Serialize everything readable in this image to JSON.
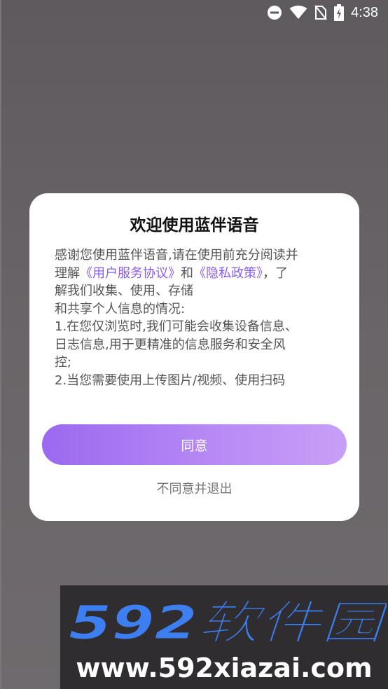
{
  "status_bar": {
    "time": "4:38",
    "icons": [
      "do-not-disturb-icon",
      "wifi-icon",
      "no-sim-icon",
      "battery-charging-icon"
    ]
  },
  "dialog": {
    "title": "欢迎使用蓝伴语音",
    "body": {
      "line1": "感谢您使用蓝伴语音,请在使用前充分阅读并",
      "line2_prefix": "理解",
      "user_agreement_link": "《用户服务协议》",
      "line2_and": "和",
      "privacy_policy_link": "《隐私政策》",
      "line2_suffix": "，了",
      "line3": "解我们收集、使用、存储",
      "line4": "和共享个人信息的情况:",
      "line5": "1.在您仅浏览时,我们可能会收集设备信息、",
      "line6": "日志信息,用于更精准的信息服务和安全风",
      "line7": "控;",
      "line8": "2.当您需要使用上传图片/视频、使用扫码"
    },
    "agree_label": "同意",
    "disagree_label": "不同意并退出"
  },
  "watermark": {
    "logo_text": "592软件园",
    "url": "www.592xiazai.com"
  },
  "colors": {
    "link": "#8a5cf0",
    "button_gradient_start": "#9a69f0",
    "button_gradient_end": "#c79ff7",
    "logo_blue": "#3d7ef0"
  }
}
